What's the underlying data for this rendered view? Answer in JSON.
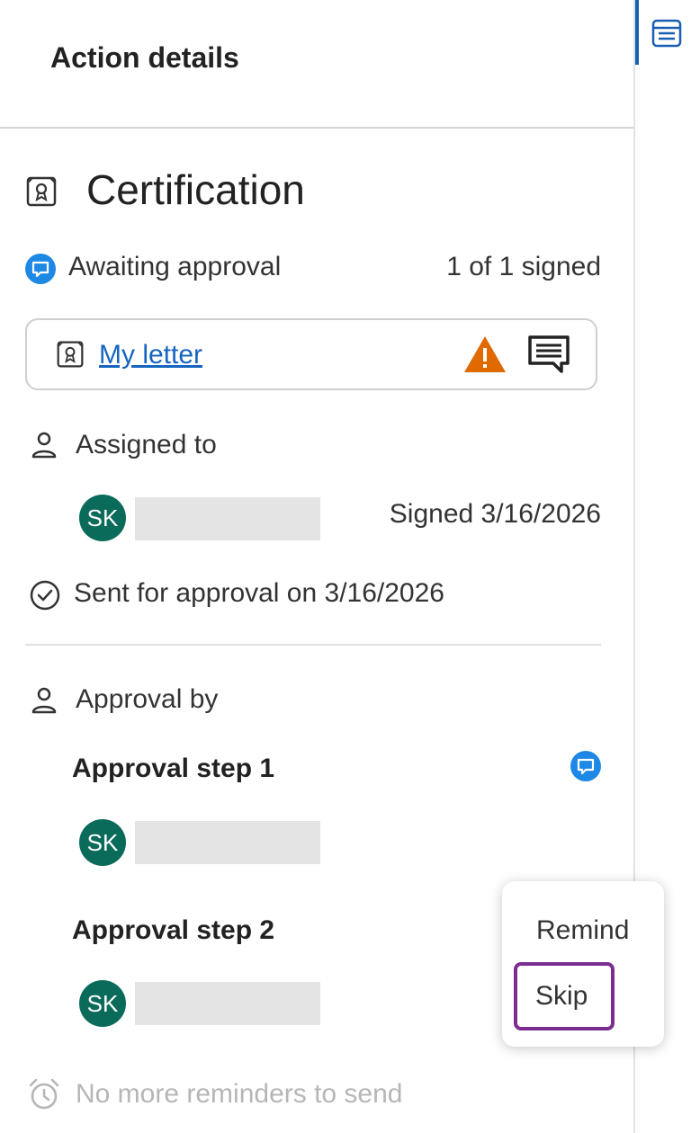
{
  "header": {
    "title": "Action details"
  },
  "section": {
    "title": "Certification"
  },
  "status": {
    "label": "Awaiting approval",
    "signed_count": "1 of 1 signed"
  },
  "document": {
    "link_label": "My letter"
  },
  "assigned": {
    "label": "Assigned to",
    "assignee": {
      "initials": "SK",
      "status": "Signed 3/16/2026"
    }
  },
  "sent": {
    "label": "Sent for approval on 3/16/2026"
  },
  "approval": {
    "label": "Approval by",
    "steps": [
      {
        "title": "Approval step 1",
        "initials": "SK"
      },
      {
        "title": "Approval step 2",
        "initials": "SK"
      }
    ]
  },
  "menu": {
    "remind": "Remind",
    "skip": "Skip"
  },
  "reminders": {
    "label": "No more reminders to send"
  },
  "colors": {
    "accent_blue": "#1e88e5",
    "avatar_green": "#0b6b5b",
    "warning_orange": "#e06a00",
    "focus_purple": "#7b2d90",
    "link_blue": "#1565c0"
  },
  "icons": [
    "list-panel-icon",
    "certificate-icon",
    "chat-bubble-icon",
    "warning-icon",
    "comment-icon",
    "person-icon",
    "check-circle-icon",
    "alarm-clock-icon"
  ]
}
